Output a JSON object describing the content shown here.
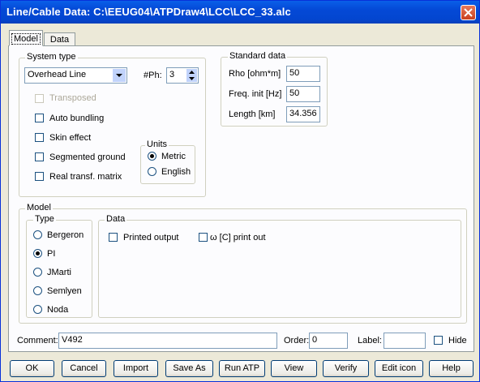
{
  "window": {
    "title": "Line/Cable Data: C:\\EEUG04\\ATPDraw4\\LCC\\LCC_33.alc"
  },
  "tabs": [
    {
      "label": "Model"
    },
    {
      "label": "Data"
    }
  ],
  "system_type": {
    "legend": "System type",
    "type_value": "Overhead Line",
    "ph_label": "#Ph:",
    "ph_value": "3",
    "checks": [
      {
        "label": "Transposed",
        "checked": false,
        "disabled": true
      },
      {
        "label": "Auto bundling",
        "checked": false
      },
      {
        "label": "Skin effect",
        "checked": false
      },
      {
        "label": "Segmented ground",
        "checked": false
      },
      {
        "label": "Real transf. matrix",
        "checked": false
      }
    ],
    "units": {
      "legend": "Units",
      "options": [
        {
          "label": "Metric",
          "selected": true
        },
        {
          "label": "English",
          "selected": false
        }
      ]
    }
  },
  "standard_data": {
    "legend": "Standard data",
    "rho_label": "Rho [ohm*m]",
    "rho_value": "50",
    "freq_label": "Freq. init [Hz]",
    "freq_value": "50",
    "length_label": "Length [km]",
    "length_value": "34.356"
  },
  "model": {
    "legend": "Model",
    "type_legend": "Type",
    "types": [
      {
        "label": "Bergeron",
        "selected": false
      },
      {
        "label": "PI",
        "selected": true
      },
      {
        "label": "JMarti",
        "selected": false
      },
      {
        "label": "Semlyen",
        "selected": false
      },
      {
        "label": "Noda",
        "selected": false
      }
    ],
    "data_legend": "Data",
    "printed_output": "Printed output",
    "print_out": "ω [C] print out"
  },
  "bottom": {
    "comment_label": "Comment:",
    "comment_value": "V492",
    "order_label": "Order:",
    "order_value": "0",
    "label_label": "Label:",
    "label_value": "",
    "hide_label": "Hide"
  },
  "buttons": [
    "OK",
    "Cancel",
    "Import",
    "Save As",
    "Run ATP",
    "View",
    "Verify",
    "Edit icon",
    "Help"
  ],
  "colors": {
    "titlebar": "#0449d6",
    "dialog_bg": "#ece9d8",
    "panel_bg": "#fcfcfe",
    "close": "#c9401e"
  }
}
